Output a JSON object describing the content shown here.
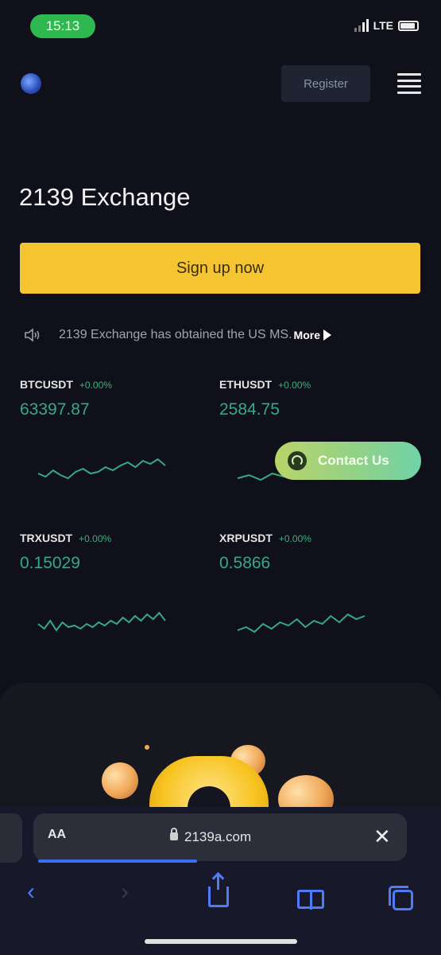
{
  "status_bar": {
    "time": "15:13",
    "network": "LTE"
  },
  "header": {
    "register_label": "Register"
  },
  "hero": {
    "title": "2139 Exchange",
    "signup_label": "Sign up now"
  },
  "notice": {
    "text": "2139 Exchange has obtained the US MS.",
    "more_label": "More"
  },
  "tickers": [
    {
      "pair": "BTCUSDT",
      "change": "+0.00%",
      "price": "63397.87",
      "sparkline": [
        28,
        32,
        24,
        30,
        34,
        26,
        22,
        28,
        26,
        20,
        24,
        18,
        14,
        20,
        12,
        16,
        10,
        18
      ]
    },
    {
      "pair": "ETHUSDT",
      "change": "+0.00%",
      "price": "2584.75",
      "sparkline": [
        34,
        30,
        36,
        28,
        32,
        26,
        30,
        24,
        28,
        22,
        26,
        20
      ]
    },
    {
      "pair": "TRXUSDT",
      "change": "+0.00%",
      "price": "0.15029",
      "sparkline": [
        24,
        30,
        20,
        32,
        22,
        28,
        26,
        30,
        24,
        28,
        22,
        26,
        20,
        24,
        16,
        22,
        14,
        20,
        12,
        18,
        10,
        20
      ]
    },
    {
      "pair": "XRPUSDT",
      "change": "+0.00%",
      "price": "0.5866",
      "sparkline": [
        32,
        28,
        34,
        24,
        30,
        22,
        26,
        18,
        28,
        20,
        24,
        14,
        22,
        12,
        18,
        14
      ]
    }
  ],
  "contact": {
    "label": "Contact Us"
  },
  "browser": {
    "aa_label": "AA",
    "url": "2139a.com",
    "close_glyph": "✕",
    "back_glyph": "‹",
    "forward_glyph": "›"
  },
  "colors": {
    "accent": "#f5c531",
    "up": "#36a88a",
    "link": "#4f7cf5"
  }
}
